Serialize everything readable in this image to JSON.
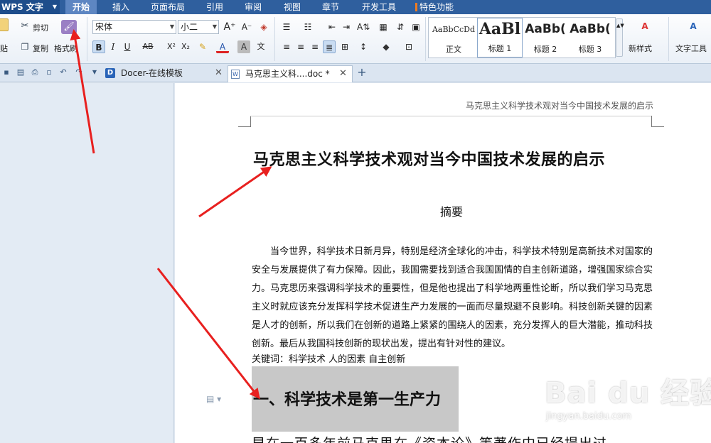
{
  "app": {
    "name": "WPS 文字"
  },
  "menu": {
    "tabs": [
      "开始",
      "插入",
      "页面布局",
      "引用",
      "审阅",
      "视图",
      "章节",
      "开发工具",
      "特色功能"
    ],
    "active": "开始"
  },
  "ribbon": {
    "paste": "贴",
    "cut": "剪切",
    "copy": "复制",
    "format_painter": "格式刷",
    "font_name": "宋体",
    "font_size": "小二",
    "styles": [
      {
        "sample": "AaBbCcDd",
        "name": "正文"
      },
      {
        "sample": "AaBl",
        "name": "标题 1"
      },
      {
        "sample": "AaBb(",
        "name": "标题 2"
      },
      {
        "sample": "AaBb(",
        "name": "标题 3"
      }
    ],
    "new_style": "新样式",
    "text_tools": "文字工具"
  },
  "tabs": {
    "docer": "Docer-在线模板",
    "document": "马克思主义科....doc *"
  },
  "document": {
    "header": "马克思主义科学技术观对当今中国技术发展的启示",
    "title": "马克思主义科学技术观对当今中国技术发展的启示",
    "abstract_heading": "摘要",
    "abstract_body": "当今世界，科学技术日新月异，特别是经济全球化的冲击，科学技术特别是高新技术对国家的安全与发展提供了有力保障。因此，我国需要找到适合我国国情的自主创新道路，增强国家综合实力。马克思历来强调科学技术的重要性，但是他也提出了科学地两重性论断，所以我们学习马克思主义时就应该充分发挥科学技术促进生产力发展的一面而尽量规避不良影响。科技创新关键的因素是人才的创新，所以我们在创新的道路上紧紧的围绕人的因素，充分发挥人的巨大潜能，推动科技创新。最后从我国科技创新的现状出发，提出有针对性的建议。",
    "keywords": "关键词：科学技术  人的因素  自主创新",
    "heading1": "一、科学技术是第一生产力",
    "next_line": "早在一百多年前马克思在《资本论》等著作中已经提出过"
  },
  "watermark": {
    "brand": "Bai du 经验",
    "url": "jingyan.baidu.com"
  },
  "colors": {
    "menubar": "#2f5f9e",
    "arrow": "#e8201f",
    "selection": "#c8c8c8"
  }
}
